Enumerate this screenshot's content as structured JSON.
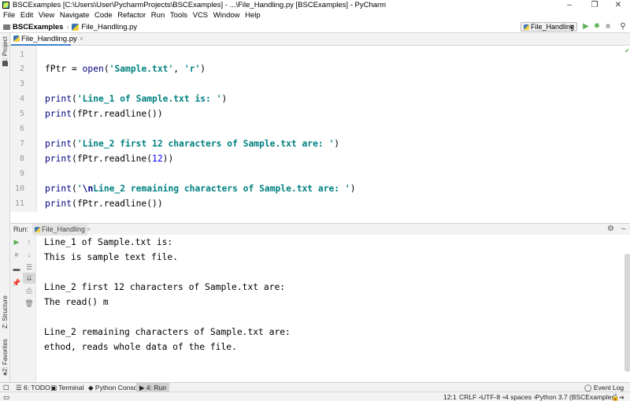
{
  "window": {
    "title": "BSCExamples [C:\\Users\\User\\PycharmProjects\\BSCExamples] - ...\\File_Handling.py [BSCExamples] - PyCharm",
    "minimize": "–",
    "restore": "❐",
    "close": "✕"
  },
  "menu": [
    "File",
    "Edit",
    "View",
    "Navigate",
    "Code",
    "Refactor",
    "Run",
    "Tools",
    "VCS",
    "Window",
    "Help"
  ],
  "navbar": {
    "project": "BSCExamples",
    "file": "File_Handling.py",
    "run_config": "File_Handling",
    "run_config_arrow": "∨"
  },
  "left_tools": {
    "project_tab": "1: Project",
    "structure_tab": "Z: Structure",
    "favorites_tab": "2: Favorites"
  },
  "editor": {
    "tab_label": "File_Handling.py",
    "line_numbers": [
      "1",
      "2",
      "3",
      "4",
      "5",
      "6",
      "7",
      "8",
      "9",
      "10",
      "11"
    ]
  },
  "run_panel": {
    "label": "Run:",
    "tab_label": "File_Handling",
    "output": [
      "Line_1 of Sample.txt is:",
      "This is sample text file.",
      "",
      "Line_2 first 12 characters of Sample.txt are:",
      "The read() m",
      "",
      "Line_2 remaining characters of Sample.txt are:",
      "ethod, reads whole data of the file."
    ]
  },
  "tool_windows": {
    "todo": "6: TODO",
    "terminal": "Terminal",
    "python_console": "Python Console",
    "run": "4: Run",
    "event_log": "Event Log"
  },
  "status": {
    "position": "12:1",
    "line_sep": "CRLF ÷",
    "encoding": "UTF-8 ÷",
    "indent": "4 spaces ÷",
    "interpreter": "Python 3.7 (BSCExamples) ÷"
  },
  "colors": {
    "accent": "#4083c9",
    "keyword": "#000080",
    "string": "#008080",
    "number": "#0000ff",
    "run_green": "#5fb057"
  }
}
